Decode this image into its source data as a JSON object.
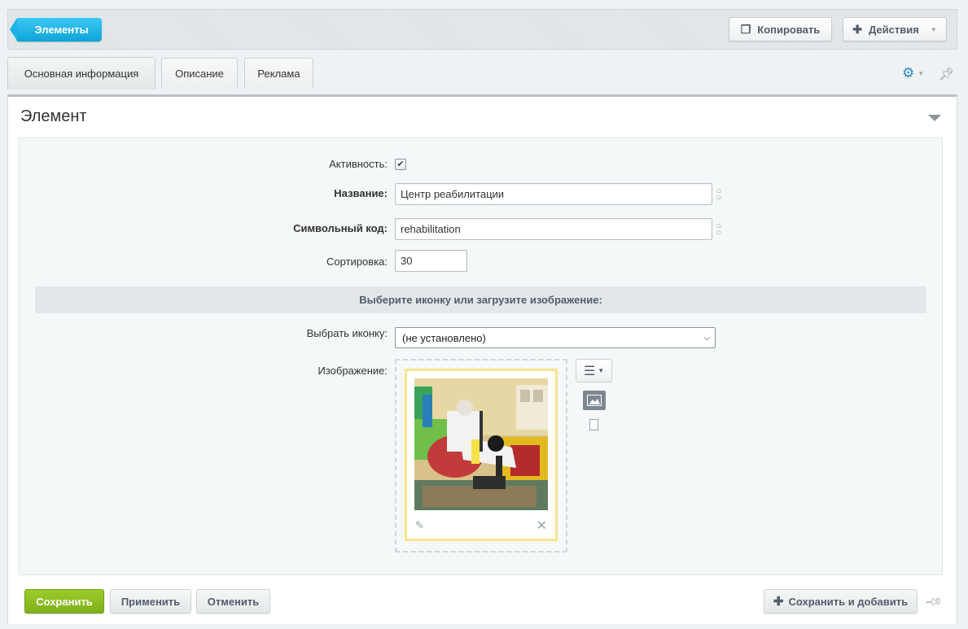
{
  "toolbar": {
    "breadcrumb_label": "Элементы",
    "copy_label": "Копировать",
    "actions_label": "Действия"
  },
  "tabs": [
    {
      "label": "Основная информация",
      "active": true
    },
    {
      "label": "Описание",
      "active": false
    },
    {
      "label": "Реклама",
      "active": false
    }
  ],
  "section": {
    "title": "Элемент"
  },
  "form": {
    "active_label": "Активность:",
    "active_checked": true,
    "name_label": "Название:",
    "name_value": "Центр реабилитации",
    "code_label": "Символьный код:",
    "code_value": "rehabilitation",
    "sort_label": "Сортировка:",
    "sort_value": "30",
    "image_section_header": "Выберите иконку или загрузите изображение:",
    "icon_label": "Выбрать иконку:",
    "icon_selected": "(не установлено)",
    "image_label": "Изображение:"
  },
  "footer": {
    "save_label": "Сохранить",
    "apply_label": "Применить",
    "cancel_label": "Отменить",
    "save_add_label": "Сохранить и добавить"
  },
  "colors": {
    "accent_blue": "#1db4e8",
    "save_green": "#8bbd22",
    "gear_blue": "#2b86c9"
  }
}
